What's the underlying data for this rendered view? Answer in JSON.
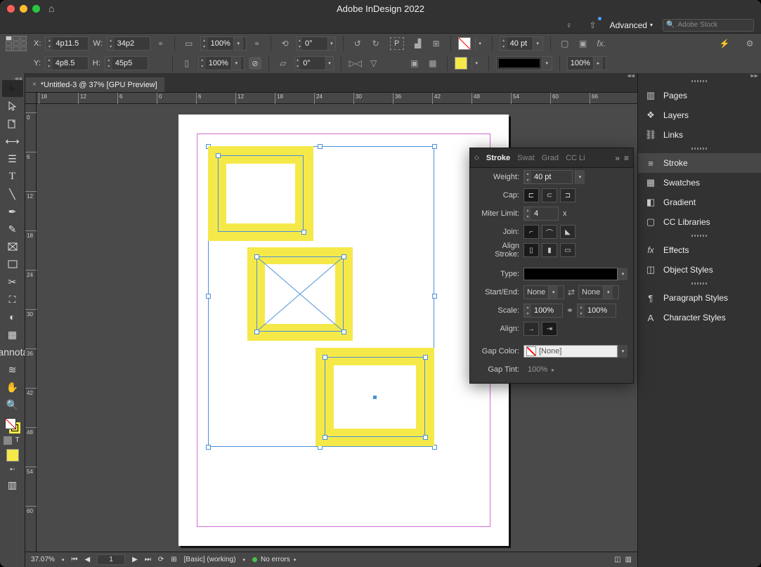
{
  "app": {
    "title": "Adobe InDesign 2022",
    "workspace": "Advanced",
    "search_placeholder": "Adobe Stock"
  },
  "document": {
    "tab_title": "*Untitled-3 @ 37% [GPU Preview]"
  },
  "control": {
    "x": "4p11.5",
    "y": "4p8.5",
    "w": "34p2",
    "h": "45p5",
    "scale_x": "100%",
    "scale_y": "100%",
    "rotate": "0°",
    "shear": "0°",
    "stroke_weight": "40 pt",
    "tint": "100%"
  },
  "ruler_h": [
    "18",
    "12",
    "6",
    "0",
    "6",
    "12",
    "18",
    "24",
    "30",
    "36",
    "42",
    "48",
    "54",
    "60",
    "66"
  ],
  "ruler_v": [
    "0",
    "6",
    "12",
    "18",
    "24",
    "30",
    "36",
    "42",
    "48",
    "54",
    "60"
  ],
  "stroke_panel": {
    "tabs": [
      "Stroke",
      "Swat",
      "Grad",
      "CC Li"
    ],
    "weight_label": "Weight:",
    "weight": "40 pt",
    "cap_label": "Cap:",
    "miter_label": "Miter Limit:",
    "miter": "4",
    "miter_unit": "x",
    "join_label": "Join:",
    "align_label": "Align Stroke:",
    "type_label": "Type:",
    "startend_label": "Start/End:",
    "start": "None",
    "end": "None",
    "scale_label": "Scale:",
    "scale_start": "100%",
    "scale_end": "100%",
    "align2_label": "Align:",
    "gapcolor_label": "Gap Color:",
    "gapcolor": "[None]",
    "gaptint_label": "Gap Tint:",
    "gaptint": "100%"
  },
  "right_panels": {
    "group1": [
      "Pages",
      "Layers",
      "Links"
    ],
    "group2": [
      "Stroke",
      "Swatches",
      "Gradient",
      "CC Libraries"
    ],
    "group3": [
      "Effects",
      "Object Styles"
    ],
    "group4": [
      "Paragraph Styles",
      "Character Styles"
    ]
  },
  "status": {
    "zoom": "37.07%",
    "page": "1",
    "preset": "[Basic] (working)",
    "errors": "No errors"
  },
  "colors": {
    "selection_yellow": "#f5e94a"
  }
}
